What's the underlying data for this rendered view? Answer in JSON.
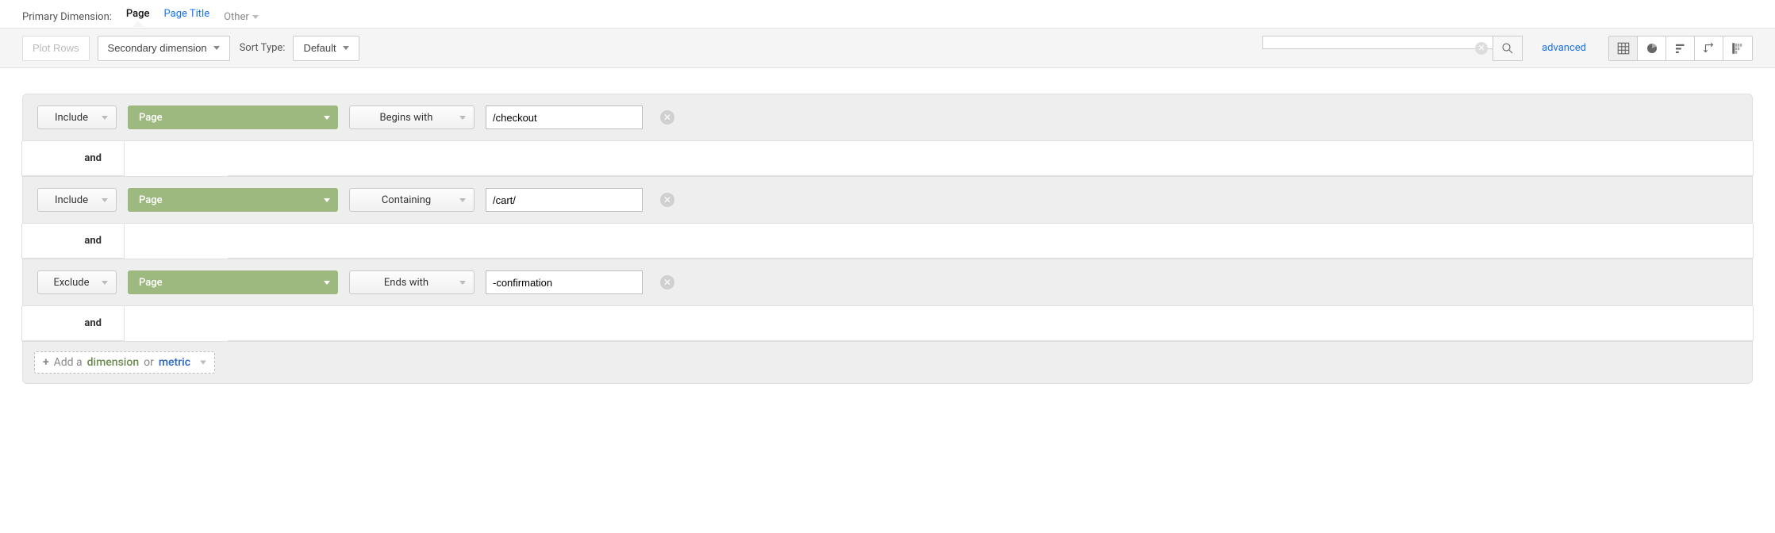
{
  "primary_dimension": {
    "label": "Primary Dimension:",
    "tabs": [
      {
        "label": "Page",
        "active": true
      },
      {
        "label": "Page Title",
        "active": false
      },
      {
        "label": "Other",
        "active": false,
        "is_other": true
      }
    ]
  },
  "toolbar": {
    "plot_rows": "Plot Rows",
    "secondary_dimension": "Secondary dimension",
    "sort_type_label": "Sort Type:",
    "sort_type_value": "Default",
    "search_value": "",
    "search_placeholder": "",
    "advanced": "advanced",
    "view_icons": [
      "table-icon",
      "pie-icon",
      "bars-icon",
      "pivot-icon",
      "compare-icon"
    ]
  },
  "filters": [
    {
      "mode": "Include",
      "dimension": "Page",
      "match": "Begins with",
      "value": "/checkout"
    },
    {
      "mode": "Include",
      "dimension": "Page",
      "match": "Containing",
      "value": "/cart/"
    },
    {
      "mode": "Exclude",
      "dimension": "Page",
      "match": "Ends with",
      "value": "-confirmation"
    }
  ],
  "connector": "and",
  "add_filter": {
    "plus": "+",
    "prefix": "Add a ",
    "dimension": "dimension",
    "or": " or ",
    "metric": "metric"
  }
}
